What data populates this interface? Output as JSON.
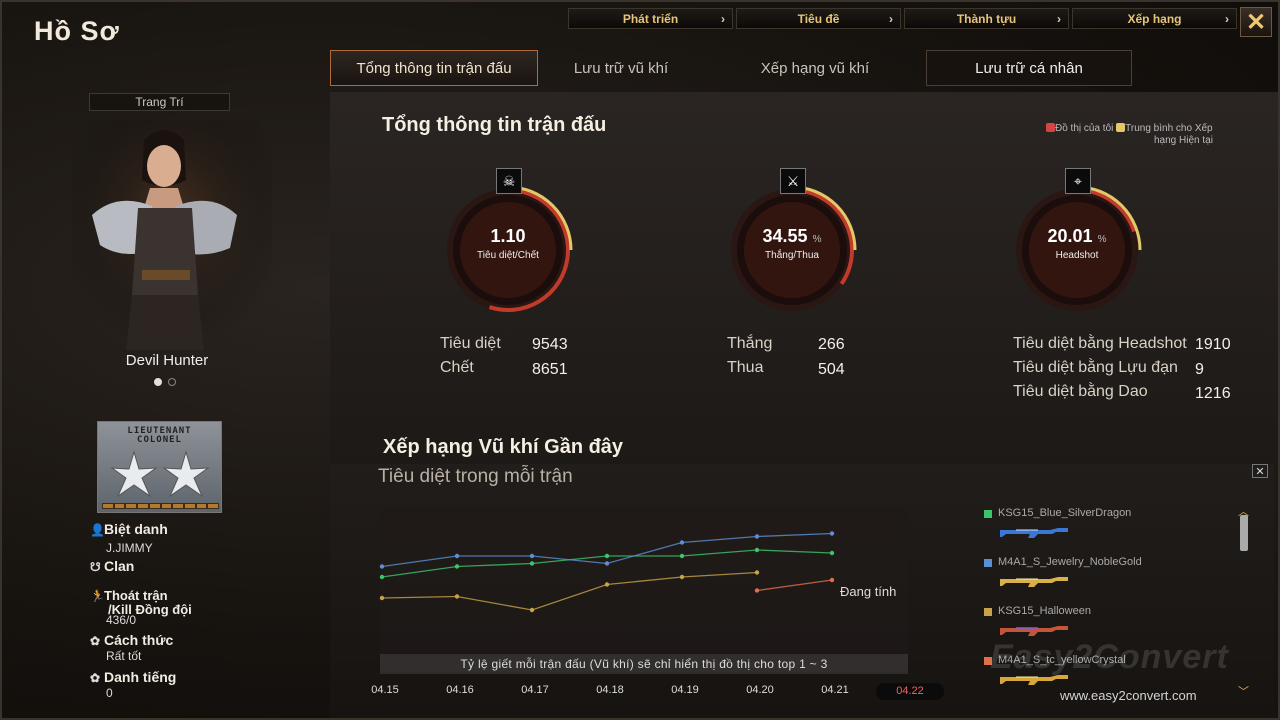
{
  "window": {
    "title": "Hồ Sơ",
    "close_icon": "close-icon"
  },
  "topnav": [
    {
      "label": "Phát triển"
    },
    {
      "label": "Tiêu đề"
    },
    {
      "label": "Thành tựu"
    },
    {
      "label": "Xếp hạng"
    }
  ],
  "tabs": [
    {
      "label": "Tổng thông tin trận đấu",
      "active": true
    },
    {
      "label": "Lưu trữ vũ khí"
    },
    {
      "label": "Xếp hạng vũ khí"
    },
    {
      "label": "Lưu trữ cá nhân"
    }
  ],
  "left": {
    "decor_label": "Trang Trí",
    "character_name": "Devil Hunter",
    "rank_title_1": "LIEUTENANT",
    "rank_title_2": "COLONEL",
    "nickname_label": "Biệt danh",
    "nickname_value": "J.JIMMY",
    "clan_label": "Clan",
    "escape_label_1": "Thoát trận",
    "escape_label_2": "/Kill Đồng đội",
    "escape_value": "436/0",
    "manner_label": "Cách thức",
    "manner_value": "Rất tốt",
    "fame_label": "Danh tiếng",
    "fame_value": "0"
  },
  "summary": {
    "title": "Tổng thông tin trận đấu",
    "legend_mine": "Đồ thị của tôi",
    "legend_avg_1": "Trung bình cho Xếp",
    "legend_avg_2": "hạng Hiện tại",
    "gauges": [
      {
        "value": "1.10",
        "unit": "",
        "label": "Tiêu diệt/Chết",
        "icon": "skull-icon",
        "fill": 0.55
      },
      {
        "value": "34.55",
        "unit": "%",
        "label": "Thắng/Thua",
        "icon": "crossed-swords-icon",
        "fill": 0.3455
      },
      {
        "value": "20.01",
        "unit": "%",
        "label": "Headshot",
        "icon": "crosshair-icon",
        "fill": 0.2001
      }
    ],
    "kills_label": "Tiêu diệt",
    "kills_value": "9543",
    "deaths_label": "Chết",
    "deaths_value": "8651",
    "wins_label": "Thắng",
    "wins_value": "266",
    "losses_label": "Thua",
    "losses_value": "504",
    "hs_kills_label": "Tiêu diệt bằng Headshot",
    "hs_kills_value": "1910",
    "grenade_kills_label": "Tiêu diệt bằng Lựu đạn",
    "grenade_kills_value": "9",
    "knife_kills_label": "Tiêu diệt bằng Dao",
    "knife_kills_value": "1216"
  },
  "recent": {
    "title": "Xếp hạng Vũ khí Gần đây",
    "chart_title": "Tiêu diệt trong mỗi trận",
    "counting_label": "Đang tính",
    "note": "Tỷ lệ giết mỗi trận đấu (Vũ khí) sẽ chỉ hiển thị đồ thị cho top 1 ~ 3",
    "weapons": [
      {
        "name": "KSG15_Blue_SilverDragon",
        "color": "#3ec46b"
      },
      {
        "name": "M4A1_S_Jewelry_NobleGold",
        "color": "#5d8fd6"
      },
      {
        "name": "KSG15_Halloween",
        "color": "#c9a24a"
      },
      {
        "name": "M4A1_S_tc_yellowCrystal",
        "color": "#e0704a"
      }
    ]
  },
  "chart_data": {
    "type": "line",
    "title": "Tiêu diệt trong mỗi trận",
    "x": [
      "04.15",
      "04.16",
      "04.17",
      "04.18",
      "04.19",
      "04.20",
      "04.21",
      "04.22"
    ],
    "active_x": "04.22",
    "ylim": [
      0,
      100
    ],
    "grid": false,
    "series": [
      {
        "name": "KSG15_Blue_SilverDragon",
        "color": "#3ec46b",
        "values": [
          50,
          57,
          59,
          64,
          64,
          68,
          66,
          null
        ]
      },
      {
        "name": "M4A1_S_Jewelry_NobleGold",
        "color": "#5d8fd6",
        "values": [
          57,
          64,
          64,
          59,
          73,
          77,
          79,
          null
        ]
      },
      {
        "name": "KSG15_Halloween",
        "color": "#c9a24a",
        "values": [
          36,
          37,
          28,
          45,
          50,
          53,
          null,
          null
        ]
      },
      {
        "name": "M4A1_S_tc_yellowCrystal",
        "color": "#e0704a",
        "values": [
          null,
          null,
          null,
          null,
          null,
          41,
          48,
          null
        ]
      }
    ]
  },
  "watermark": {
    "brand": "Easy2Convert",
    "url": "www.easy2convert.com"
  }
}
